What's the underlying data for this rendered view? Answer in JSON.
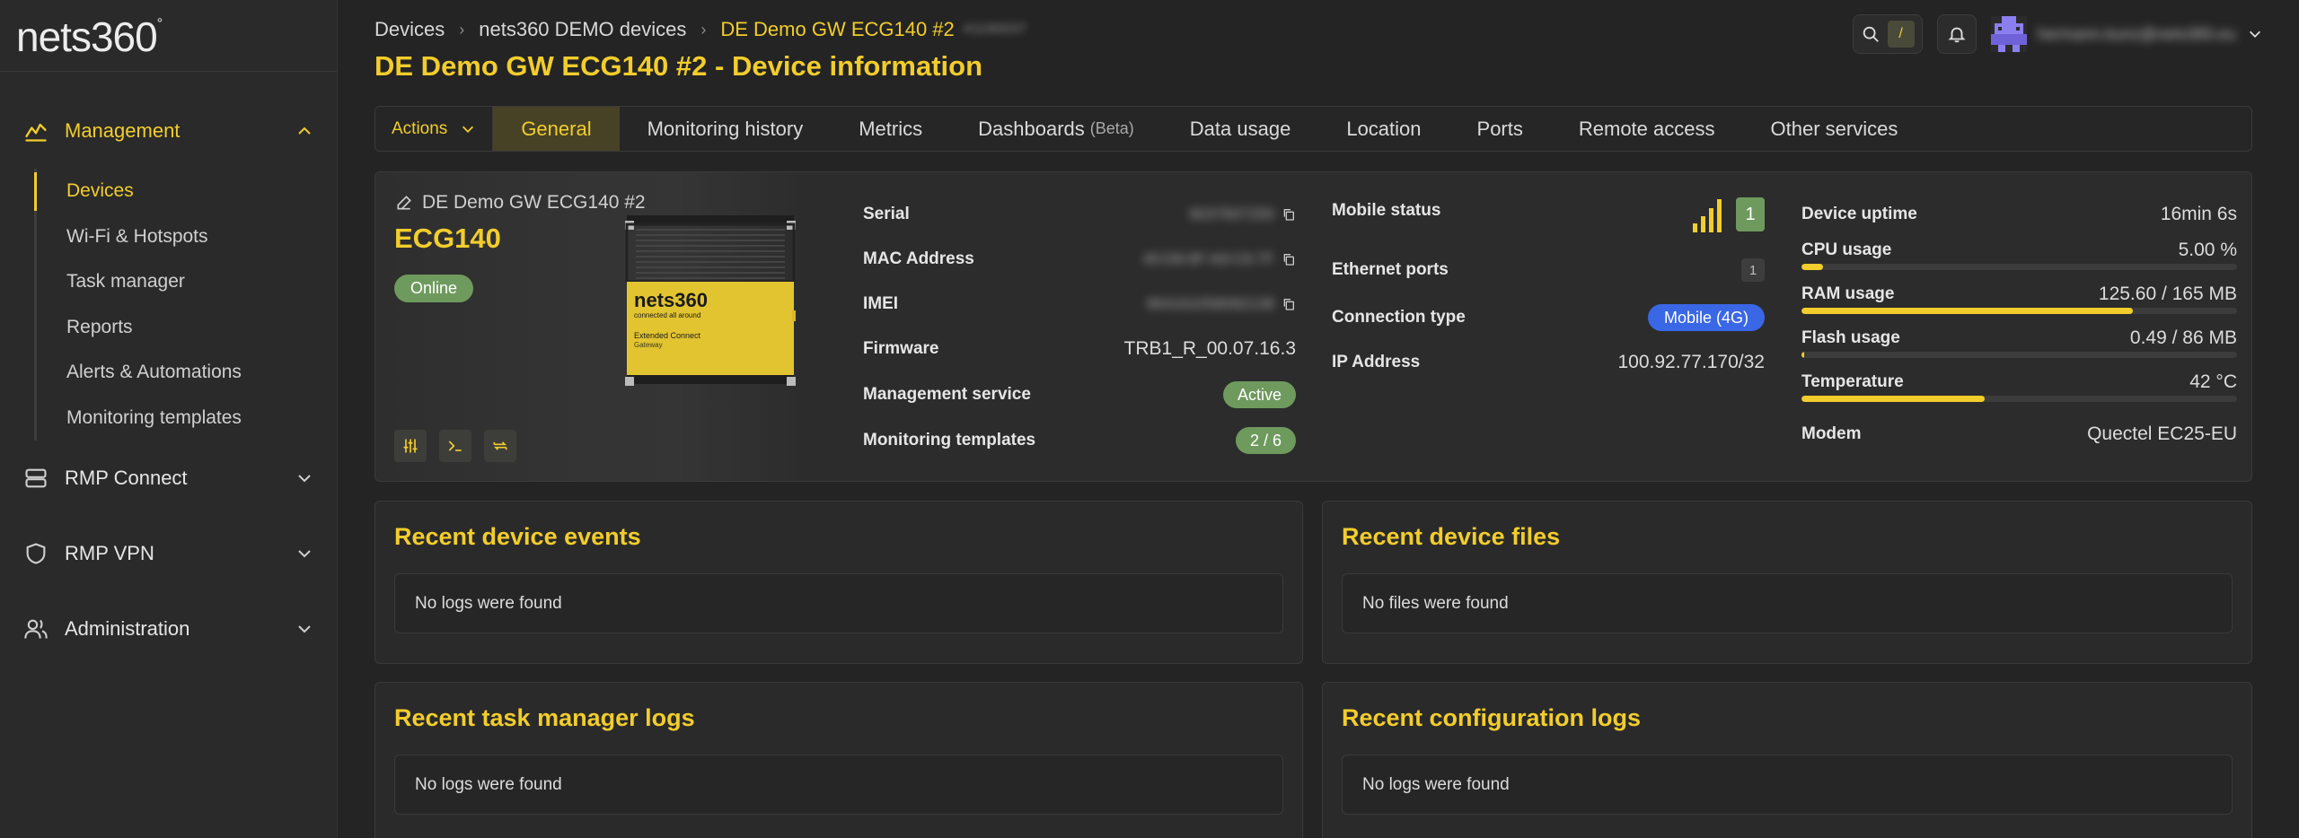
{
  "brand": {
    "logo_text": "nets360",
    "logo_degree": "°"
  },
  "sidebar": {
    "sections": [
      {
        "label": "Management",
        "icon": "activity-icon",
        "expanded": true
      },
      {
        "label": "RMP Connect",
        "icon": "server-icon",
        "expanded": false
      },
      {
        "label": "RMP VPN",
        "icon": "shield-icon",
        "expanded": false
      },
      {
        "label": "Administration",
        "icon": "users-icon",
        "expanded": false
      }
    ],
    "management_items": [
      {
        "label": "Devices",
        "active": true
      },
      {
        "label": "Wi-Fi & Hotspots"
      },
      {
        "label": "Task manager"
      },
      {
        "label": "Reports"
      },
      {
        "label": "Alerts & Automations"
      },
      {
        "label": "Monitoring templates"
      }
    ]
  },
  "header": {
    "breadcrumbs": [
      "Devices",
      "nets360 DEMO devices",
      "DE Demo GW ECG140 #2"
    ],
    "breadcrumb_blurred": "#1190037",
    "title": "DE Demo GW ECG140 #2 - Device information",
    "search_shortcut": "/",
    "user_email": "hermann.kunz@nets360.eu"
  },
  "tabs": {
    "actions_label": "Actions",
    "items": [
      {
        "label": "General",
        "active": true
      },
      {
        "label": "Monitoring history"
      },
      {
        "label": "Metrics"
      },
      {
        "label": "Dashboards",
        "suffix": "(Beta)"
      },
      {
        "label": "Data usage"
      },
      {
        "label": "Location"
      },
      {
        "label": "Ports"
      },
      {
        "label": "Remote access"
      },
      {
        "label": "Other services"
      }
    ]
  },
  "device": {
    "name": "DE Demo GW ECG140 #2",
    "model": "ECG140",
    "status": "Online",
    "hw_brand": "nets360",
    "hw_tagline": "connected all around",
    "hw_product": "Extended Connect",
    "hw_product_sub": "Gateway",
    "serial_label": "Serial",
    "serial_value": "6037607250",
    "mac_label": "MAC Address",
    "mac_value": "40:D8:9F:A9:C6:7F",
    "imei_label": "IMEI",
    "imei_value": "864161058092138",
    "firmware_label": "Firmware",
    "firmware_value": "TRB1_R_00.07.16.3",
    "mgmt_label": "Management service",
    "mgmt_value": "Active",
    "templates_label": "Monitoring templates",
    "templates_value": "2 / 6",
    "mobile_label": "Mobile status",
    "sim_slot": "1",
    "signal_bars": 4,
    "eth_label": "Ethernet ports",
    "eth_port": "1",
    "conn_label": "Connection type",
    "conn_value": "Mobile (4G)",
    "ip_label": "IP Address",
    "ip_value": "100.92.77.170/32",
    "uptime_label": "Device uptime",
    "uptime_value": "16min 6s",
    "cpu_label": "CPU usage",
    "cpu_value": "5.00 %",
    "cpu_fraction": 0.05,
    "ram_label": "RAM usage",
    "ram_value": "125.60 / 165 MB",
    "ram_fraction": 0.761,
    "flash_label": "Flash usage",
    "flash_value": "0.49 / 86 MB",
    "flash_fraction": 0.006,
    "temp_label": "Temperature",
    "temp_value": "42 °C",
    "temp_fraction": 0.42,
    "modem_label": "Modem",
    "modem_value": "Quectel EC25-EU"
  },
  "panels": {
    "events": {
      "title": "Recent device events",
      "empty": "No logs were found"
    },
    "files": {
      "title": "Recent device files",
      "empty": "No files were found"
    },
    "tasks": {
      "title": "Recent task manager logs",
      "empty": "No logs were found"
    },
    "config": {
      "title": "Recent configuration logs",
      "empty": "No logs were found"
    }
  },
  "colors": {
    "accent": "#f2cd2c",
    "success": "#6f9a5e",
    "info": "#3a67e6"
  }
}
